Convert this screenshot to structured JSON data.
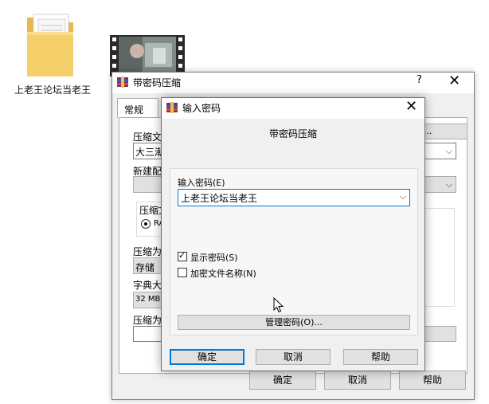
{
  "desktop": {
    "folder_label": "上老王论坛当老王"
  },
  "back_window": {
    "title": "带密码压缩",
    "help_glyph": "?",
    "close_glyph": "✕",
    "tab_general": "常规",
    "frag_archive_name": "压缩文",
    "frag_archive_value": "大三潮",
    "frag_new_profile": "新建配",
    "frag_archive_format": "压缩文",
    "frag_rar": "RA",
    "frag_compression_method": "压缩为",
    "frag_method_value": "存储",
    "frag_dict_size": "字典大",
    "frag_dict_value": "32 MB",
    "frag_split": "压缩为",
    "frag_profiles_btn": "B)...",
    "ok": "确定",
    "cancel": "取消",
    "help": "帮助"
  },
  "dialog": {
    "title": "输入密码",
    "close_glyph": "✕",
    "heading": "带密码压缩",
    "password_label": "输入密码(E)",
    "password_value": "上老王论坛当老王",
    "chevron": "⌵",
    "show_password": "显示密码(S)",
    "show_password_checked": true,
    "encrypt_names": "加密文件名称(N)",
    "encrypt_names_checked": false,
    "manage_button": "管理密码(O)...",
    "ok": "确定",
    "cancel": "取消",
    "help": "帮助"
  }
}
